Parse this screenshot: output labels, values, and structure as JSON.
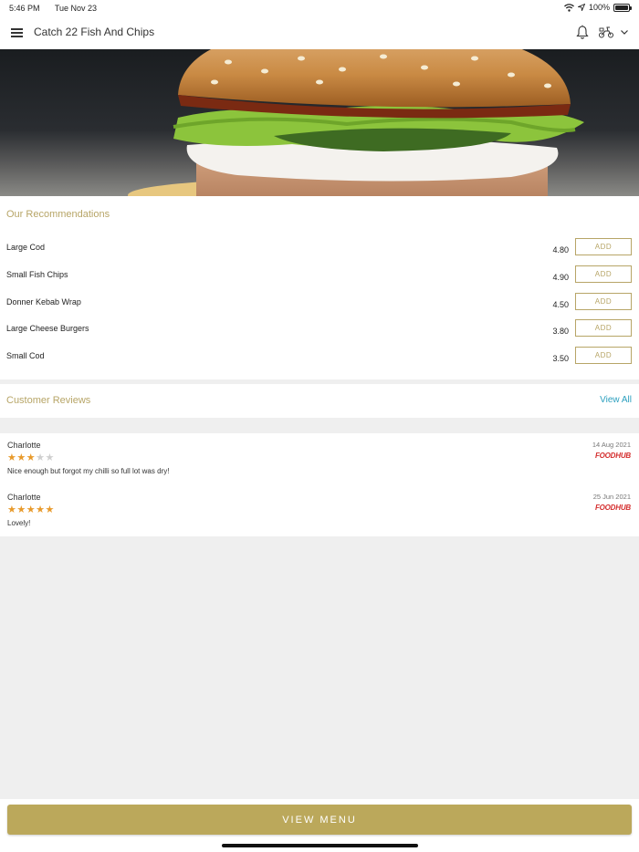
{
  "status_bar": {
    "time": "5:46 PM",
    "date": "Tue Nov 23",
    "battery": "100%"
  },
  "header": {
    "title": "Catch 22 Fish And Chips"
  },
  "recommendations": {
    "title": "Our Recommendations",
    "add_label": "ADD",
    "items": [
      {
        "name": "Large Cod",
        "price": "4.80"
      },
      {
        "name": "Small Fish Chips",
        "price": "4.90"
      },
      {
        "name": "Donner Kebab Wrap",
        "price": "4.50"
      },
      {
        "name": "Large Cheese Burgers",
        "price": "3.80"
      },
      {
        "name": "Small Cod",
        "price": "3.50"
      }
    ]
  },
  "reviews": {
    "title": "Customer Reviews",
    "view_all": "View All",
    "items": [
      {
        "name": "Charlotte",
        "rating": 3,
        "max_rating": 5,
        "comment": "Nice enough but forgot my chilli so full lot was dry!",
        "date": "14 Aug 2021",
        "source": "FOODHUB"
      },
      {
        "name": "Charlotte",
        "rating": 5,
        "max_rating": 5,
        "comment": "Lovely!",
        "date": "25 Jun 2021",
        "source": "FOODHUB"
      }
    ]
  },
  "footer": {
    "view_menu": "VIEW MENU"
  },
  "colors": {
    "accent": "#b7a567",
    "button": "#bba85b",
    "link": "#2a9fbe",
    "star": "#e89a2b",
    "brand_red": "#d42e2e"
  },
  "icons": [
    "menu-icon",
    "bell-icon",
    "scooter-icon",
    "chevron-down-icon",
    "wifi-icon",
    "location-arrow-icon",
    "battery-icon",
    "star-icon"
  ]
}
